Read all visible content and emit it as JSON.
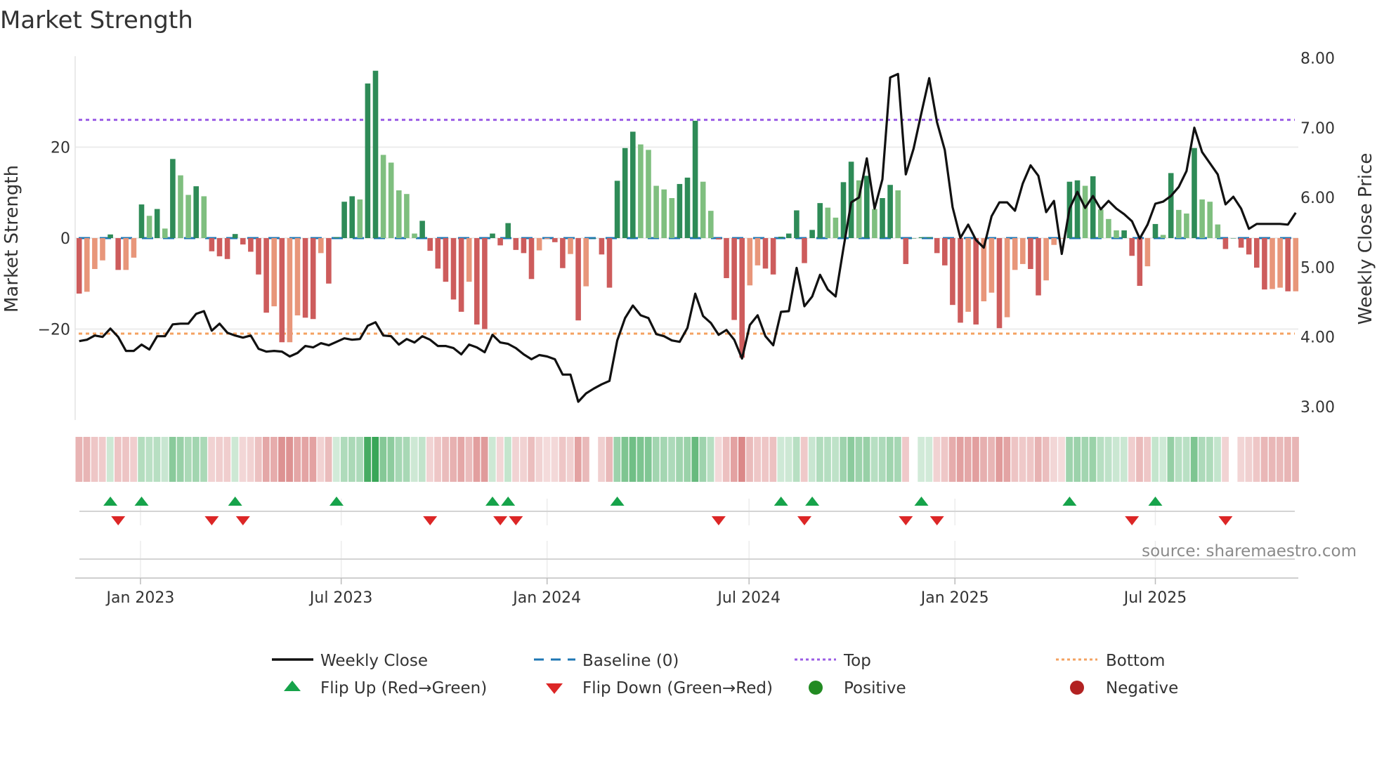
{
  "chart_data": {
    "type": "bar",
    "title": "Market Strength",
    "ylabel": "Market Strength",
    "y2label": "Weekly Close Price",
    "source": "source: sharemaestro.com",
    "ylim": [
      -40,
      40
    ],
    "y2lim": [
      2.81,
      8.03
    ],
    "yticks": [
      {
        "value": 20,
        "label": "20"
      },
      {
        "value": 0,
        "label": "0"
      },
      {
        "value": -20,
        "label": "−20"
      }
    ],
    "y2ticks": [
      {
        "value": 8,
        "label": "8.00"
      },
      {
        "value": 7,
        "label": "7.00"
      },
      {
        "value": 6,
        "label": "6.00"
      },
      {
        "value": 5,
        "label": "5.00"
      },
      {
        "value": 4,
        "label": "4.00"
      },
      {
        "value": 3,
        "label": "3.00"
      }
    ],
    "xticks": [
      {
        "week": 7.86,
        "label": "Jan 2023"
      },
      {
        "week": 33.6,
        "label": "Jul 2023"
      },
      {
        "week": 60.0,
        "label": "Jan 2024"
      },
      {
        "week": 85.9,
        "label": "Jul 2024"
      },
      {
        "week": 112.3,
        "label": "Jan 2025"
      },
      {
        "week": 138.0,
        "label": "Jul 2025"
      }
    ],
    "top_level": 26,
    "bottom_level": -21,
    "baseline": 0,
    "strength": [
      -12.2,
      -11.8,
      -6.8,
      -4.9,
      0.8,
      -7,
      -7,
      -4.3,
      7.4,
      4.9,
      6.4,
      2.1,
      17.4,
      13.8,
      9.5,
      11.4,
      9.2,
      -2.9,
      -4.0,
      -4.6,
      0.9,
      -1.4,
      -3.0,
      -8,
      -16.4,
      -15,
      -22.9,
      -22.9,
      -17,
      -17.5,
      -17.8,
      -3.3,
      -10,
      0.2,
      8,
      9.2,
      8.5,
      34,
      36.8,
      18.3,
      16.6,
      10.5,
      9.7,
      1,
      3.8,
      -2.8,
      -6.7,
      -9.6,
      -13.5,
      -16.2,
      -9.6,
      -19,
      -20,
      1,
      -1.6,
      3.3,
      -2.6,
      -3.3,
      -9,
      -2.7,
      -0.2,
      -0.9,
      -6.6,
      -3.5,
      -18.1,
      -10.6,
      0,
      -3.6,
      -10.9,
      12.6,
      19.8,
      23.4,
      20.6,
      19.4,
      11.5,
      10.7,
      8.8,
      11.9,
      13.3,
      25.8,
      12.4,
      6,
      -0.3,
      -8.8,
      -18,
      -26.3,
      -10.4,
      -6,
      -6.7,
      -8,
      0.3,
      1,
      6.1,
      -5.5,
      1.8,
      7.7,
      6.7,
      4.5,
      12.3,
      16.8,
      12.7,
      13.7,
      6.4,
      8.8,
      11.7,
      10.5,
      -5.7,
      0,
      0.2,
      0.2,
      -3.3,
      -6,
      -14.7,
      -18.6,
      -16.2,
      -19,
      -13.9,
      -12,
      -19.8,
      -17.4,
      -7,
      -5.7,
      -6.8,
      -12.6,
      -9.3,
      -1.5,
      -0.1,
      12.4,
      12.7,
      11.5,
      13.6,
      6.3,
      4.2,
      1.7,
      1.7,
      -3.9,
      -10.5,
      -6.2,
      3.1,
      0.7,
      14.3,
      6.2,
      5.4,
      19.8,
      8.5,
      8,
      3,
      -2.4,
      0,
      -2.1,
      -3.6,
      -6.5,
      -11.3,
      -11.2,
      -10.9,
      -11.7,
      -11.7
    ],
    "weekly_close": [
      3.94,
      3.96,
      4.02,
      4.0,
      4.12,
      4.0,
      3.8,
      3.8,
      3.89,
      3.82,
      4.01,
      4.01,
      4.18,
      4.19,
      4.19,
      4.33,
      4.37,
      4.09,
      4.19,
      4.06,
      4.02,
      3.99,
      4.02,
      3.83,
      3.79,
      3.8,
      3.79,
      3.72,
      3.77,
      3.87,
      3.85,
      3.91,
      3.88,
      3.93,
      3.98,
      3.96,
      3.97,
      4.16,
      4.21,
      4.02,
      4.01,
      3.89,
      3.97,
      3.92,
      4.01,
      3.96,
      3.87,
      3.87,
      3.84,
      3.75,
      3.89,
      3.85,
      3.78,
      4.03,
      3.92,
      3.9,
      3.84,
      3.75,
      3.68,
      3.74,
      3.72,
      3.68,
      3.46,
      3.46,
      3.07,
      3.19,
      3.26,
      3.32,
      3.37,
      3.95,
      4.27,
      4.45,
      4.31,
      4.27,
      4.04,
      4.01,
      3.95,
      3.93,
      4.13,
      4.62,
      4.3,
      4.2,
      4.03,
      4.1,
      3.96,
      3.69,
      4.17,
      4.31,
      4.01,
      3.88,
      4.36,
      4.37,
      4.99,
      4.44,
      4.58,
      4.89,
      4.68,
      4.58,
      5.27,
      5.93,
      6.0,
      6.56,
      5.84,
      6.26,
      7.72,
      7.77,
      6.33,
      6.7,
      7.21,
      7.71,
      7.08,
      6.68,
      5.86,
      5.42,
      5.61,
      5.39,
      5.28,
      5.73,
      5.93,
      5.93,
      5.81,
      6.2,
      6.46,
      6.31,
      5.79,
      5.95,
      5.19,
      5.84,
      6.08,
      5.85,
      6.02,
      5.83,
      5.95,
      5.84,
      5.76,
      5.66,
      5.41,
      5.61,
      5.91,
      5.94,
      6.02,
      6.15,
      6.38,
      7.0,
      6.65,
      6.49,
      6.33,
      5.9,
      6.01,
      5.84,
      5.55,
      5.62,
      5.62,
      5.62,
      5.62,
      5.61,
      5.78
    ],
    "flip_up_weeks": [
      4,
      8,
      20,
      33,
      53,
      55,
      69,
      90,
      94,
      108,
      127,
      138
    ],
    "flip_down_weeks": [
      5,
      17,
      21,
      45,
      54,
      56,
      82,
      93,
      106,
      110,
      135,
      147
    ],
    "colors": {
      "rising_positive": "#2e8b57",
      "falling_positive": "#7fbf7f",
      "falling_negative": "#cd5c5c",
      "rising_negative": "#e8967a",
      "heat_positive": "#2ca04c",
      "heat_negative": "#cd5c5c",
      "weekly_close": "#111111",
      "baseline": "#1f77b4",
      "top": "#9b5de5",
      "bottom": "#f4a261",
      "flip_up": "#16a34a",
      "flip_down": "#dc2626",
      "positive": "#228b22",
      "negative": "#b22222"
    },
    "legend": {
      "weekly_close": "Weekly Close",
      "baseline": "Baseline (0)",
      "top": "Top",
      "bottom": "Bottom",
      "flip_up": "Flip Up (Red→Green)",
      "flip_down": "Flip Down (Green→Red)",
      "positive": "Positive",
      "negative": "Negative"
    }
  }
}
